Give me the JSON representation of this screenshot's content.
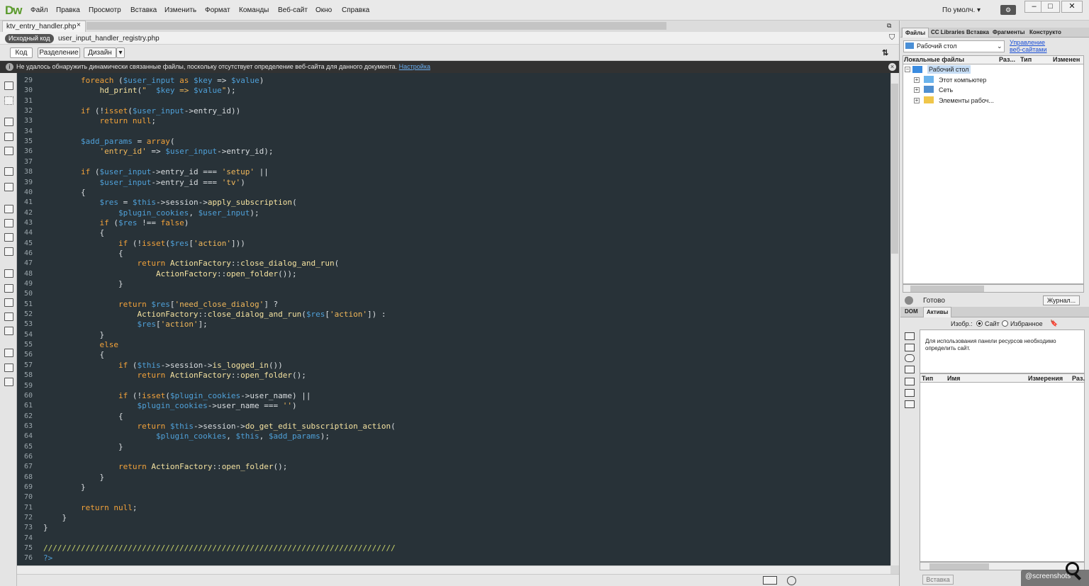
{
  "app": {
    "logo": "Dw",
    "menu": [
      "Файл",
      "Правка",
      "Просмотр",
      "Вставка",
      "Изменить",
      "Формат",
      "Команды",
      "Веб-сайт",
      "Окно",
      "Справка"
    ],
    "layout_selector": "По умолч. ▾",
    "window_controls": [
      "–",
      "□",
      "✕"
    ]
  },
  "document": {
    "active_tab": "ktv_entry_handler.php",
    "tab_close": "×",
    "source_badge": "Исходный код",
    "related_file": "user_input_handler_registry.php",
    "views": [
      "Код",
      "Разделение",
      "Дизайн"
    ],
    "view_dropdown": "▾"
  },
  "info_bar": {
    "text": "Не удалось обнаружить динамически связанные файлы, поскольку отсутствует определение веб-сайта для данного документа.",
    "link": "Настройка",
    "icon": "i",
    "close": "×"
  },
  "code_lines": [
    {
      "n": "29",
      "html": "        <span class='k'>foreach</span> (<span class='v'>$user_input</span> <span class='k'>as</span> <span class='v'>$key</span> => <span class='v'>$value</span>)"
    },
    {
      "n": "30",
      "html": "            <span class='fn'>hd_print</span>(<span class='s'>\"  </span><span class='v'>$key</span><span class='s'> => </span><span class='v'>$value</span><span class='s'>\"</span>);"
    },
    {
      "n": "31",
      "html": ""
    },
    {
      "n": "32",
      "html": "        <span class='k'>if</span> (!<span class='k'>isset</span>(<span class='v'>$user_input</span>->entry_id))"
    },
    {
      "n": "33",
      "html": "            <span class='k'>return</span> <span class='k'>null</span>;"
    },
    {
      "n": "34",
      "html": ""
    },
    {
      "n": "35",
      "html": "        <span class='v'>$add_params</span> = <span class='k'>array</span>("
    },
    {
      "n": "36",
      "html": "            <span class='s'>'entry_id'</span> => <span class='v'>$user_input</span>->entry_id);"
    },
    {
      "n": "37",
      "html": ""
    },
    {
      "n": "38",
      "html": "        <span class='k'>if</span> (<span class='v'>$user_input</span>->entry_id === <span class='s'>'setup'</span> ||"
    },
    {
      "n": "39",
      "html": "            <span class='v'>$user_input</span>->entry_id === <span class='s'>'tv'</span>)"
    },
    {
      "n": "40",
      "html": "        {"
    },
    {
      "n": "41",
      "html": "            <span class='v'>$res</span> = <span class='v'>$this</span>->session-><span class='fn'>apply_subscription</span>("
    },
    {
      "n": "42",
      "html": "                <span class='v'>$plugin_cookies</span>, <span class='v'>$user_input</span>);"
    },
    {
      "n": "43",
      "html": "            <span class='k'>if</span> (<span class='v'>$res</span> !== <span class='k'>false</span>)"
    },
    {
      "n": "44",
      "html": "            {"
    },
    {
      "n": "45",
      "html": "                <span class='k'>if</span> (!<span class='k'>isset</span>(<span class='v'>$res</span>[<span class='s'>'action'</span>]))"
    },
    {
      "n": "46",
      "html": "                {"
    },
    {
      "n": "47",
      "html": "                    <span class='k'>return</span> <span class='fn'>ActionFactory</span>::<span class='fn'>close_dialog_and_run</span>("
    },
    {
      "n": "48",
      "html": "                        <span class='fn'>ActionFactory</span>::<span class='fn'>open_folder</span>());"
    },
    {
      "n": "49",
      "html": "                }"
    },
    {
      "n": "50",
      "html": ""
    },
    {
      "n": "51",
      "html": "                <span class='k'>return</span> <span class='v'>$res</span>[<span class='s'>'need_close_dialog'</span>] ?"
    },
    {
      "n": "52",
      "html": "                    <span class='fn'>ActionFactory</span>::<span class='fn'>close_dialog_and_run</span>(<span class='v'>$res</span>[<span class='s'>'action'</span>]) :"
    },
    {
      "n": "53",
      "html": "                    <span class='v'>$res</span>[<span class='s'>'action'</span>];"
    },
    {
      "n": "54",
      "html": "            }"
    },
    {
      "n": "55",
      "html": "            <span class='k'>else</span>"
    },
    {
      "n": "56",
      "html": "            {"
    },
    {
      "n": "57",
      "html": "                <span class='k'>if</span> (<span class='v'>$this</span>->session-><span class='fn'>is_logged_in</span>())"
    },
    {
      "n": "58",
      "html": "                    <span class='k'>return</span> <span class='fn'>ActionFactory</span>::<span class='fn'>open_folder</span>();"
    },
    {
      "n": "59",
      "html": ""
    },
    {
      "n": "60",
      "html": "                <span class='k'>if</span> (!<span class='k'>isset</span>(<span class='v'>$plugin_cookies</span>->user_name) ||"
    },
    {
      "n": "61",
      "html": "                    <span class='v'>$plugin_cookies</span>->user_name === <span class='s'>''</span>)"
    },
    {
      "n": "62",
      "html": "                {"
    },
    {
      "n": "63",
      "html": "                    <span class='k'>return</span> <span class='v'>$this</span>->session-><span class='fn'>do_get_edit_subscription_action</span>("
    },
    {
      "n": "64",
      "html": "                        <span class='v'>$plugin_cookies</span>, <span class='v'>$this</span>, <span class='v'>$add_params</span>);"
    },
    {
      "n": "65",
      "html": "                }"
    },
    {
      "n": "66",
      "html": ""
    },
    {
      "n": "67",
      "html": "                <span class='k'>return</span> <span class='fn'>ActionFactory</span>::<span class='fn'>open_folder</span>();"
    },
    {
      "n": "68",
      "html": "            }"
    },
    {
      "n": "69",
      "html": "        }"
    },
    {
      "n": "70",
      "html": ""
    },
    {
      "n": "71",
      "html": "        <span class='k'>return</span> <span class='k'>null</span>;"
    },
    {
      "n": "72",
      "html": "    }"
    },
    {
      "n": "73",
      "html": "}"
    },
    {
      "n": "74",
      "html": ""
    },
    {
      "n": "75",
      "html": "<span class='cm'>///////////////////////////////////////////////////////////////////////////</span>"
    },
    {
      "n": "76",
      "html": "<span class='v'>?></span>"
    }
  ],
  "files_panel": {
    "tabs": [
      "Файлы",
      "CC Libraries",
      "Вставка",
      "Фрагменты",
      "Конструкто"
    ],
    "site": "Рабочий стол",
    "manage_link": "Управление веб-сайтами",
    "columns": [
      "Локальные файлы",
      "Раз...",
      "Тип",
      "Изменен"
    ],
    "tree": [
      "Рабочий стол",
      "Этот компьютер",
      "Сеть",
      "Элементы рабоч..."
    ],
    "status": "Готово",
    "journal": "Журнал..."
  },
  "assets_panel": {
    "tabs": [
      "DOM",
      "Активы"
    ],
    "images_label": "Изобр.:",
    "radio_site": "Сайт",
    "radio_fav": "Избранное",
    "message": "Для использования панели ресурсов необходимо определить сайт.",
    "columns": [
      "Тип",
      "Имя",
      "Измерения",
      "Раз."
    ],
    "insert": "Вставка"
  },
  "watermark": "@screenshots",
  "colors": {
    "editor_bg": "#283238",
    "keyword": "#f2a23a",
    "variable": "#4fa0d8",
    "string": "#f0b75a"
  }
}
